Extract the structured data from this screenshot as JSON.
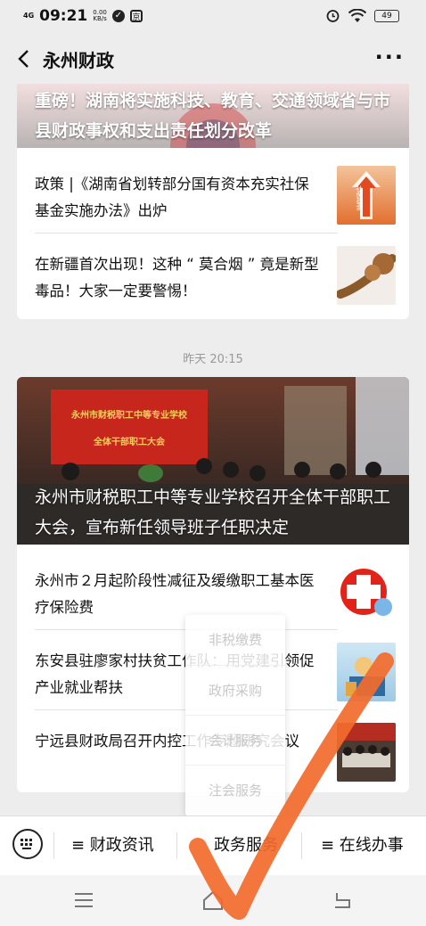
{
  "status": {
    "network": "4G",
    "time": "09:21",
    "speed_value": "0.00",
    "speed_unit": "KB/s",
    "app_badge": "京",
    "battery": "49"
  },
  "header": {
    "title": "永州财政"
  },
  "card1": {
    "hero_title": "重磅！湖南将实施科技、教育、交通领域省与市县财政事权和支出责任划分改革",
    "items": [
      {
        "text": "政策 |《湖南省划转部分国有资本充实社保基金实施办法》出炉",
        "thumb_label": "社保基金"
      },
      {
        "text": "在新疆首次出现！这种 “ 莫合烟 ” 竟是新型毒品！大家一定要警惕！"
      }
    ]
  },
  "timestamp": "昨天 20:15",
  "card2": {
    "banner_line1": "永州市财税职工中等专业学校",
    "banner_line2": "全体干部职工大会",
    "hero_title": "永州市财税职工中等专业学校召开全体干部职工大会，宣布新任领导班子任职决定",
    "items": [
      {
        "text": "永州市２月起阶段性减征及缓缴职工基本医疗保险费"
      },
      {
        "text": "东安县驻廖家村扶贫工作队：用党建引领促产业就业帮扶"
      },
      {
        "text": "宁远县财政局召开内控工作专题研究会议"
      }
    ]
  },
  "popup": {
    "items": [
      "非税缴费",
      "政府采购",
      "会计服务",
      "注会服务"
    ]
  },
  "menu": {
    "items": [
      "≡ 财政资讯",
      "政务服务",
      "≡ 在线办事"
    ]
  },
  "colors": {
    "accent_check": "#f26b2c",
    "banner_red": "#c7261c"
  }
}
